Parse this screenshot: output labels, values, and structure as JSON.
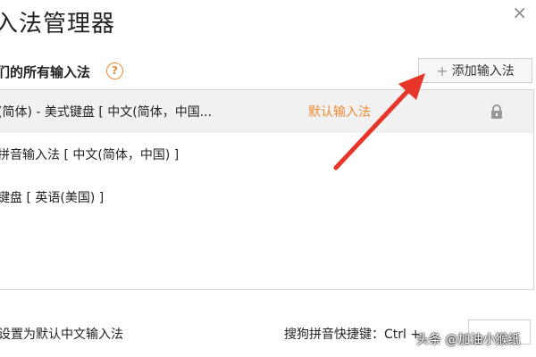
{
  "window": {
    "title": "入法管理器",
    "close_symbol": "×"
  },
  "section": {
    "label": "们的所有输入法",
    "help_symbol": "?"
  },
  "add_button": {
    "plus": "+",
    "label": "添加输入法"
  },
  "input_methods": [
    {
      "name": "(简体) - 美式键盘  [ 中文(简体，中国...",
      "default_tag": "默认输入法",
      "locked": true,
      "selected": true
    },
    {
      "name": "拼音输入法  [ 中文(简体，中国) ]",
      "default_tag": "",
      "locked": false,
      "selected": false
    },
    {
      "name": "键盘  [ 英语(美国) ]",
      "default_tag": "",
      "locked": false,
      "selected": false
    }
  ],
  "footer": {
    "set_default_label": "设置为默认中文输入法",
    "shortcut_label": "搜狗拼音快捷键：",
    "shortcut_value": "Ctrl +"
  },
  "watermark": "头条 @加油小猴纸",
  "colors": {
    "accent": "#f08a32",
    "arrow": "#e8352a",
    "selected_row": "#f1f1f1"
  },
  "icons": {
    "help": "question-circle-icon",
    "lock": "lock-icon",
    "close": "close-icon",
    "plus": "plus-icon"
  }
}
